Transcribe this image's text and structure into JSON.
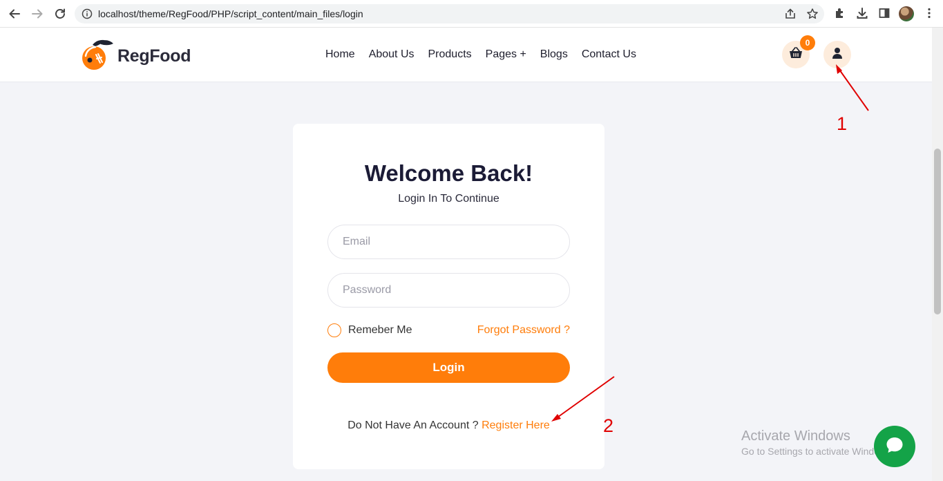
{
  "browser": {
    "url": "localhost/theme/RegFood/PHP/script_content/main_files/login",
    "icons": [
      "back-icon",
      "forward-icon",
      "reload-icon",
      "info-icon",
      "share-icon",
      "star-icon",
      "extensions-icon",
      "download-icon",
      "sidepanel-icon",
      "profile-avatar",
      "menu-icon"
    ]
  },
  "site": {
    "brand": "RegFood",
    "nav": [
      "Home",
      "About Us",
      "Products",
      "Pages +",
      "Blogs",
      "Contact Us"
    ],
    "cart_count": "0",
    "accent_color": "#ff7d0a"
  },
  "login": {
    "title": "Welcome Back!",
    "subtitle": "Login In To Continue",
    "email_placeholder": "Email",
    "password_placeholder": "Password",
    "remember_label": "Remeber Me",
    "forgot_label": "Forgot Password ?",
    "login_label": "Login",
    "no_account_text": "Do Not Have An Account ?",
    "register_label": "Register Here"
  },
  "annotations": {
    "first": "1",
    "second": "2"
  },
  "watermark": {
    "title": "Activate Windows",
    "subtitle": "Go to Settings to activate Windows."
  }
}
